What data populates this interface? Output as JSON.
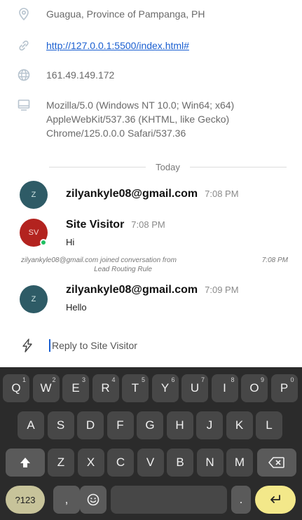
{
  "visitor_info": {
    "location": "Guagua, Province of Pampanga, PH",
    "url": "http://127.0.0.1:5500/index.html#",
    "ip": "161.49.149.172",
    "user_agent": "Mozilla/5.0 (Windows NT 10.0; Win64; x64) AppleWebKit/537.36 (KHTML, like Gecko) Chrome/125.0.0.0 Safari/537.36",
    "icons": [
      "location-pin-icon",
      "link-icon",
      "globe-icon",
      "monitor-icon"
    ]
  },
  "divider_label": "Today",
  "messages": [
    {
      "avatar_initials": "Z",
      "sender": "zilyankyle08@gmail.com",
      "time": "7:08 PM",
      "text": ""
    },
    {
      "avatar_initials": "SV",
      "sender": "Site Visitor",
      "time": "7:08 PM",
      "text": "Hi",
      "online": true
    },
    {
      "avatar_initials": "Z",
      "sender": "zilyankyle08@gmail.com",
      "time": "7:09 PM",
      "text": "Hello"
    }
  ],
  "system_note": {
    "text_line1": "zilyankyle08@gmail.com joined conversation from",
    "text_line2": "Lead Routing Rule",
    "time": "7:08 PM"
  },
  "reply": {
    "placeholder": "Reply to Site Visitor",
    "icon": "lightning-icon"
  },
  "keyboard": {
    "row1": [
      {
        "k": "Q",
        "s": "1"
      },
      {
        "k": "W",
        "s": "2"
      },
      {
        "k": "E",
        "s": "3"
      },
      {
        "k": "R",
        "s": "4"
      },
      {
        "k": "T",
        "s": "5"
      },
      {
        "k": "Y",
        "s": "6"
      },
      {
        "k": "U",
        "s": "7"
      },
      {
        "k": "I",
        "s": "8"
      },
      {
        "k": "O",
        "s": "9"
      },
      {
        "k": "P",
        "s": "0"
      }
    ],
    "row2": [
      "A",
      "S",
      "D",
      "F",
      "G",
      "H",
      "J",
      "K",
      "L"
    ],
    "row3": [
      "Z",
      "X",
      "C",
      "V",
      "B",
      "N",
      "M"
    ],
    "symbols_label": "?123",
    "comma": ",",
    "period": ".",
    "shift_icon": "shift-icon",
    "backspace_icon": "backspace-icon",
    "emoji_icon": "emoji-icon",
    "enter_icon": "enter-icon",
    "colors": {
      "background": "#2b2b2b",
      "key": "#474747",
      "enter": "#f3e88a",
      "symbols": "#c7c39a"
    }
  }
}
